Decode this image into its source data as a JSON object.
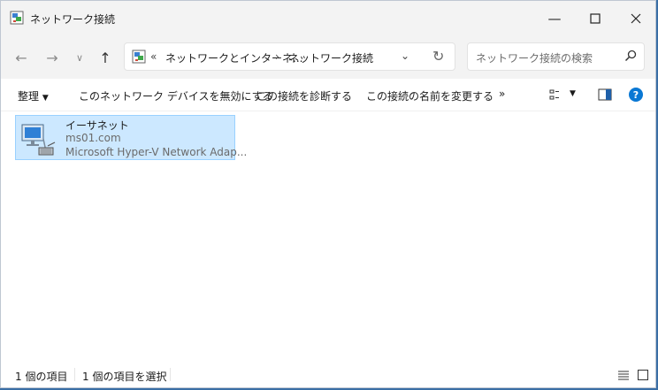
{
  "window": {
    "title": "ネットワーク接続"
  },
  "nav": {
    "addr_prefix": "«",
    "addr_seg1": "ネットワークとインターネ...",
    "addr_seg2": "ネットワーク接続",
    "search_placeholder": "ネットワーク接続の検索"
  },
  "commands": {
    "organize": "整理",
    "disable": "このネットワーク デバイスを無効にする",
    "diagnose": "この接続を診断する",
    "rename": "この接続の名前を変更する",
    "more": "»"
  },
  "items": [
    {
      "name": "イーサネット",
      "network": "ms01.com",
      "adapter": "Microsoft Hyper-V Network Adap..."
    }
  ],
  "status": {
    "count": "1 個の項目",
    "selected": "1 個の項目を選択"
  },
  "colors": {
    "accent": "#0a78d4",
    "selection": "#cce8ff"
  }
}
